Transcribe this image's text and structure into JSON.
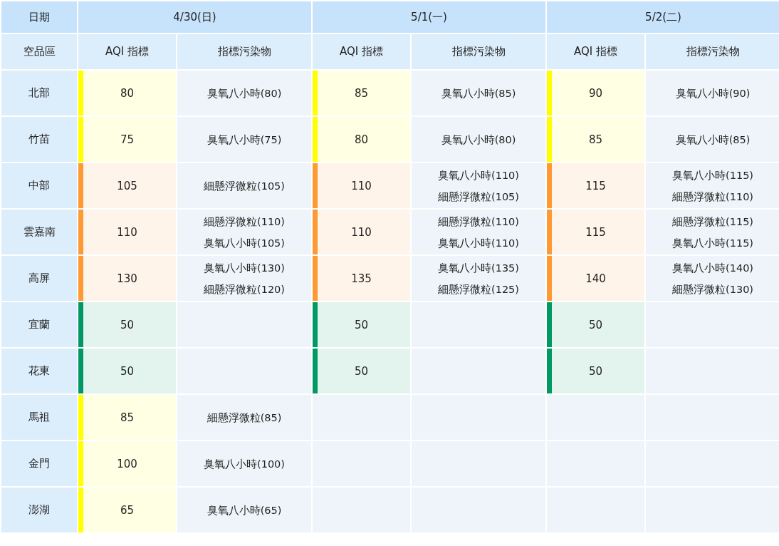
{
  "header": {
    "date_label": "日期",
    "region_label": "空品區",
    "dates": [
      "4/30(日)",
      "5/1(一)",
      "5/2(二)"
    ],
    "subheaders": [
      [
        "AQI 指標",
        "指標污染物"
      ],
      [
        "AQI 指標",
        "指標污染物"
      ],
      [
        "AQI 指標",
        "指標污染物"
      ]
    ]
  },
  "rows": [
    {
      "region": "北部",
      "days": [
        {
          "aqi": "80",
          "color": "#ffff00",
          "pollutants": [
            "臭氧八小時(80)"
          ]
        },
        {
          "aqi": "85",
          "color": "#ffff00",
          "pollutants": [
            "臭氧八小時(85)"
          ]
        },
        {
          "aqi": "90",
          "color": "#ffff00",
          "pollutants": [
            "臭氧八小時(90)"
          ]
        }
      ]
    },
    {
      "region": "竹苗",
      "days": [
        {
          "aqi": "75",
          "color": "#ffff00",
          "pollutants": [
            "臭氧八小時(75)"
          ]
        },
        {
          "aqi": "80",
          "color": "#ffff00",
          "pollutants": [
            "臭氧八小時(80)"
          ]
        },
        {
          "aqi": "85",
          "color": "#ffff00",
          "pollutants": [
            "臭氧八小時(85)"
          ]
        }
      ]
    },
    {
      "region": "中部",
      "days": [
        {
          "aqi": "105",
          "color": "#ff9933",
          "pollutants": [
            "細懸浮微粒(105)"
          ]
        },
        {
          "aqi": "110",
          "color": "#ff9933",
          "pollutants": [
            "臭氧八小時(110)",
            "細懸浮微粒(105)"
          ]
        },
        {
          "aqi": "115",
          "color": "#ff9933",
          "pollutants": [
            "臭氧八小時(115)",
            "細懸浮微粒(110)"
          ]
        }
      ]
    },
    {
      "region": "雲嘉南",
      "days": [
        {
          "aqi": "110",
          "color": "#ff9933",
          "pollutants": [
            "細懸浮微粒(110)",
            "臭氧八小時(105)"
          ]
        },
        {
          "aqi": "110",
          "color": "#ff9933",
          "pollutants": [
            "細懸浮微粒(110)",
            "臭氧八小時(110)"
          ]
        },
        {
          "aqi": "115",
          "color": "#ff9933",
          "pollutants": [
            "細懸浮微粒(115)",
            "臭氧八小時(115)"
          ]
        }
      ]
    },
    {
      "region": "高屏",
      "days": [
        {
          "aqi": "130",
          "color": "#ff9933",
          "pollutants": [
            "臭氧八小時(130)",
            "細懸浮微粒(120)"
          ]
        },
        {
          "aqi": "135",
          "color": "#ff9933",
          "pollutants": [
            "臭氧八小時(135)",
            "細懸浮微粒(125)"
          ]
        },
        {
          "aqi": "140",
          "color": "#ff9933",
          "pollutants": [
            "臭氧八小時(140)",
            "細懸浮微粒(130)"
          ]
        }
      ]
    },
    {
      "region": "宜蘭",
      "days": [
        {
          "aqi": "50",
          "color": "#009966"
        },
        {
          "aqi": "50",
          "color": "#009966"
        },
        {
          "aqi": "50",
          "color": "#009966"
        }
      ]
    },
    {
      "region": "花東",
      "days": [
        {
          "aqi": "50",
          "color": "#009966"
        },
        {
          "aqi": "50",
          "color": "#009966"
        },
        {
          "aqi": "50",
          "color": "#009966"
        }
      ]
    },
    {
      "region": "馬祖",
      "days": [
        {
          "aqi": "85",
          "color": "#ffff00",
          "pollutants": [
            "細懸浮微粒(85)"
          ]
        }
      ]
    },
    {
      "region": "金門",
      "days": [
        {
          "aqi": "100",
          "color": "#ffff00",
          "pollutants": [
            "臭氧八小時(100)"
          ]
        }
      ]
    },
    {
      "region": "澎湖",
      "days": [
        {
          "aqi": "65",
          "color": "#ffff00",
          "pollutants": [
            "臭氧八小時(65)"
          ]
        }
      ]
    }
  ]
}
